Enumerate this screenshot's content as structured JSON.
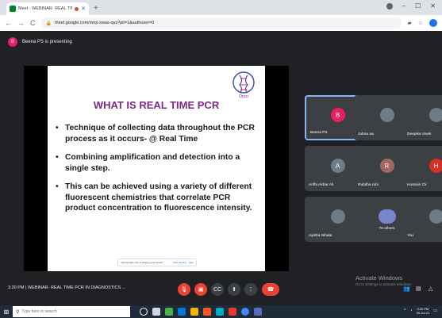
{
  "browser": {
    "tab_title": "Meet - WEBINAR- REAL TIM",
    "url": "meet.google.com/mnp-xwas-qvs?pli=1&authuser=0"
  },
  "meet": {
    "presenting_text": "Beena PS is presenting",
    "presenter_initial": "B",
    "time": "3:20 PM",
    "separator": "|",
    "meeting_title": "WEBINAR- REAL TIME PCR IN DIAGNOSTICS ..."
  },
  "slide": {
    "title": "WHAT IS REAL TIME PCR",
    "logo_text": "Onco",
    "bullets": [
      "Technique of collecting data throughout  the PCR process as it occurs- @ Real Time",
      "Combining amplification and detection into a single step.",
      "This can be achieved using a variety of different fluorescent chemistries that correlate PCR product concentration  to fluorescence intensity."
    ],
    "share_bar": {
      "text": "meet.google.com is sharing your screen.",
      "stop_label": "Stop sharing",
      "hide_label": "Hide"
    }
  },
  "participants": [
    {
      "name": "Beena PS",
      "initial": "B",
      "color": "#e91e63"
    },
    {
      "name": "Jubna aa",
      "initial": "",
      "color": "#6d7b8a"
    },
    {
      "name": "Deepika Vivek",
      "initial": "",
      "color": "#6d7b8a"
    },
    {
      "name": "Ariffa Akbar Ali",
      "initial": "A",
      "color": "#6d7b8a"
    },
    {
      "name": "Rubitha rubi",
      "initial": "R",
      "color": "#a1665e"
    },
    {
      "name": "Hussain Ck",
      "initial": "H",
      "color": "#d93025"
    },
    {
      "name": "Ayisha Nihala",
      "initial": "",
      "color": "#6d7b8a"
    },
    {
      "name": "76 others",
      "initial": "",
      "color": "#7986cb"
    },
    {
      "name": "You",
      "initial": "",
      "color": "#6d7b8a"
    }
  ],
  "watermark": {
    "line1": "Activate Windows",
    "line2": "Go to Settings to activate Windows."
  },
  "taskbar": {
    "search_placeholder": "Type here to search",
    "clock_time": "3:20 PM",
    "clock_date": "29-Jul-21"
  }
}
